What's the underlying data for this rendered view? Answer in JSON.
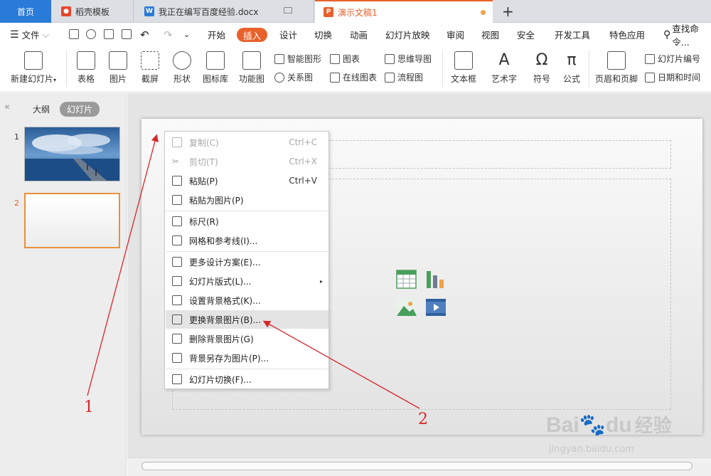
{
  "tabs": {
    "home": "首页",
    "template": "稻壳模板",
    "doc": "我正在编写百度经验.docx",
    "ppt": "演示文稿1",
    "add": "+"
  },
  "menu": {
    "file": "文件",
    "items": [
      "开始",
      "插入",
      "设计",
      "切换",
      "动画",
      "幻灯片放映",
      "审阅",
      "视图",
      "安全",
      "开发工具",
      "特色应用"
    ],
    "search": "查找命令..."
  },
  "toolbar": {
    "new_slide": "新建幻灯片",
    "table": "表格",
    "picture": "图片",
    "screenshot": "截屏",
    "shape": "形状",
    "icon_lib": "图标库",
    "function_chart": "功能图",
    "smart_shape": "智能图形",
    "chart": "图表",
    "relation": "关系图",
    "online_chart": "在线图表",
    "mindmap": "思维导图",
    "flowchart": "流程图",
    "textbox": "文本框",
    "wordart": "艺术字",
    "symbol": "符号",
    "formula": "公式",
    "header_footer": "页眉和页脚",
    "slide_number": "幻灯片编号",
    "date_time": "日期和时间"
  },
  "left": {
    "outline": "大纲",
    "slides": "幻灯片",
    "n1": "1",
    "n2": "2"
  },
  "context_menu": {
    "copy": "复制(C)",
    "copy_sc": "Ctrl+C",
    "cut": "剪切(T)",
    "cut_sc": "Ctrl+X",
    "paste": "粘贴(P)",
    "paste_sc": "Ctrl+V",
    "paste_pic": "粘贴为图片(P)",
    "ruler": "标尺(R)",
    "grid": "网格和参考线(I)...",
    "design": "更多设计方案(E)...",
    "layout": "幻灯片版式(L)...",
    "bg_format": "设置背景格式(K)...",
    "bg_change": "更换背景图片(B)...",
    "bg_delete": "删除背景图片(G)",
    "bg_save": "背景另存为图片(P)...",
    "transition": "幻灯片切换(F)..."
  },
  "annotations": {
    "a1": "1",
    "a2": "2"
  },
  "watermark": {
    "brand": "Bai",
    "brand2": "du",
    "cn": "经验",
    "url": "jingyan.baidu.com"
  }
}
